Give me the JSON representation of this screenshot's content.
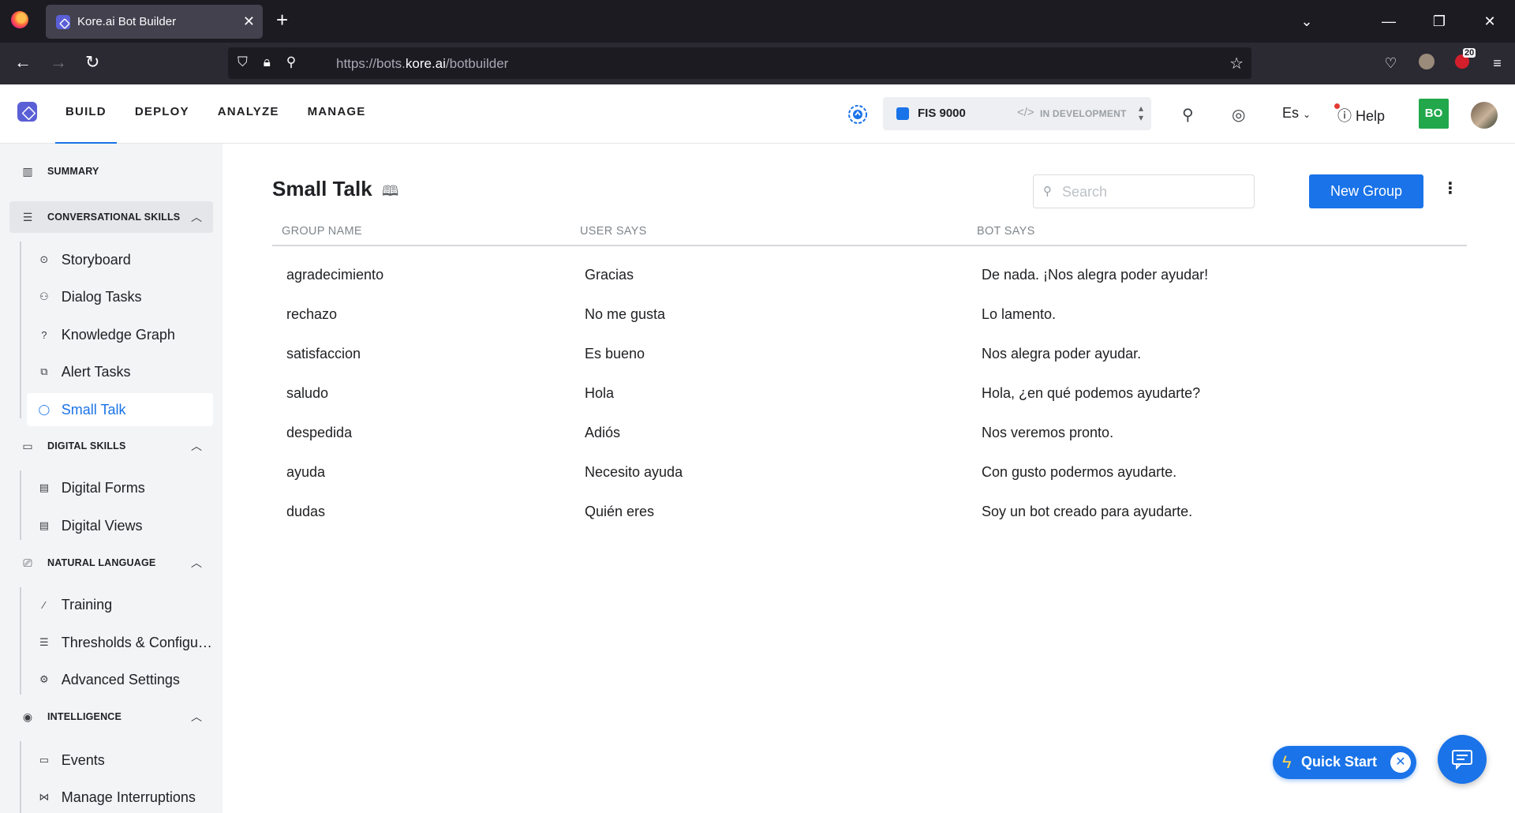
{
  "browser": {
    "tab_title": "Kore.ai Bot Builder",
    "url_prefix": "https://bots.",
    "url_domain": "kore.ai",
    "url_path": "/botbuilder",
    "extension_badge": "20"
  },
  "header": {
    "nav": [
      "BUILD",
      "DEPLOY",
      "ANALYZE",
      "MANAGE"
    ],
    "active_nav": "BUILD",
    "bot_name": "FIS 9000",
    "bot_code_icon": "</>",
    "bot_status": "IN DEVELOPMENT",
    "language": "Es",
    "help": "Help",
    "user_initials": "BO"
  },
  "sidebar": {
    "summary": "SUMMARY",
    "conversational_skills": {
      "label": "CONVERSATIONAL SKILLS",
      "items": [
        "Storyboard",
        "Dialog Tasks",
        "Knowledge Graph",
        "Alert Tasks",
        "Small Talk"
      ]
    },
    "digital_skills": {
      "label": "DIGITAL SKILLS",
      "items": [
        "Digital Forms",
        "Digital Views"
      ]
    },
    "natural_language": {
      "label": "NATURAL LANGUAGE",
      "items": [
        "Training",
        "Thresholds & Configurations",
        "Advanced Settings"
      ]
    },
    "intelligence": {
      "label": "INTELLIGENCE",
      "items": [
        "Events",
        "Manage Interruptions"
      ]
    }
  },
  "main": {
    "title": "Small Talk",
    "search_placeholder": "Search",
    "new_group_label": "New Group",
    "columns": [
      "GROUP NAME",
      "USER SAYS",
      "BOT SAYS"
    ],
    "rows": [
      {
        "group": "agradecimiento",
        "user": "Gracias",
        "bot": "De nada. ¡Nos alegra poder ayudar!"
      },
      {
        "group": "rechazo",
        "user": "No me gusta",
        "bot": "Lo lamento."
      },
      {
        "group": "satisfaccion",
        "user": "Es bueno",
        "bot": "Nos alegra poder ayudar."
      },
      {
        "group": "saludo",
        "user": "Hola",
        "bot": "Hola, ¿en qué podemos ayudarte?"
      },
      {
        "group": "despedida",
        "user": "Adiós",
        "bot": "Nos veremos pronto."
      },
      {
        "group": "ayuda",
        "user": "Necesito ayuda",
        "bot": "Con gusto podermos ayudarte."
      },
      {
        "group": "dudas",
        "user": "Quién eres",
        "bot": "Soy un bot creado para ayudarte."
      }
    ]
  },
  "floating": {
    "quick_start": "Quick Start"
  },
  "colors": {
    "accent": "#1a73e8",
    "user_badge": "#22a84b",
    "sidebar_bg": "#f3f4f6"
  }
}
